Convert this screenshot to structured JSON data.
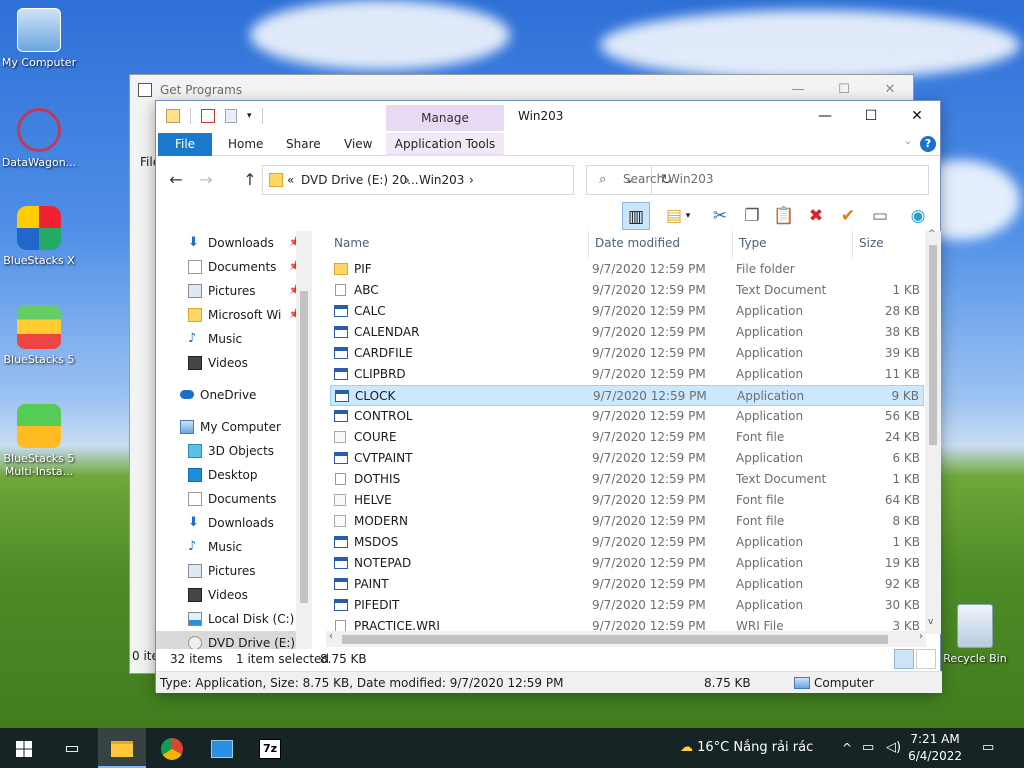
{
  "desktop": {
    "icons": [
      {
        "label": "My Computer"
      },
      {
        "label": "DataWagon..."
      },
      {
        "label": "BlueStacks X"
      },
      {
        "label": "BlueStacks 5"
      },
      {
        "label": "BlueStacks 5 Multi-Insta..."
      },
      {
        "label": "Recycle Bin"
      }
    ]
  },
  "background_window": {
    "title": "Get Programs",
    "menu_fragment": "File",
    "status_fragment": "0 ite",
    "minimize": "—",
    "maximize": "☐",
    "close": "✕"
  },
  "explorer": {
    "title": "Win203",
    "manage_tab": "Manage",
    "ribbon_tabs": {
      "file": "File",
      "home": "Home",
      "share": "Share",
      "view": "View",
      "app_tools": "Application Tools"
    },
    "controls": {
      "minimize": "—",
      "maximize": "☐",
      "close": "✕",
      "help": "?"
    },
    "address": {
      "prefix": "«",
      "segment1": "DVD Drive (E:) 20...",
      "sep1": "›",
      "segment2": "Win203",
      "sep2": "›"
    },
    "search": {
      "placeholder": "Search Win203"
    },
    "nav": {
      "quick": [
        {
          "label": "Downloads",
          "pin": true
        },
        {
          "label": "Documents",
          "pin": true
        },
        {
          "label": "Pictures",
          "pin": true
        },
        {
          "label": "Microsoft Wi",
          "pin": true
        },
        {
          "label": "Music",
          "pin": false
        },
        {
          "label": "Videos",
          "pin": false
        }
      ],
      "onedrive": "OneDrive",
      "computer": "My Computer",
      "computer_items": [
        {
          "label": "3D Objects"
        },
        {
          "label": "Desktop"
        },
        {
          "label": "Documents"
        },
        {
          "label": "Downloads"
        },
        {
          "label": "Music"
        },
        {
          "label": "Pictures"
        },
        {
          "label": "Videos"
        },
        {
          "label": "Local Disk (C:)"
        },
        {
          "label": "DVD Drive (E:) 2("
        }
      ]
    },
    "columns": {
      "name": "Name",
      "date": "Date modified",
      "type": "Type",
      "size": "Size"
    },
    "files": [
      {
        "name": "PIF",
        "date": "9/7/2020 12:59 PM",
        "type": "File folder",
        "size": "",
        "icon": "folder"
      },
      {
        "name": "ABC",
        "date": "9/7/2020 12:59 PM",
        "type": "Text Document",
        "size": "1 KB",
        "icon": "txt"
      },
      {
        "name": "CALC",
        "date": "9/7/2020 12:59 PM",
        "type": "Application",
        "size": "28 KB",
        "icon": "app"
      },
      {
        "name": "CALENDAR",
        "date": "9/7/2020 12:59 PM",
        "type": "Application",
        "size": "38 KB",
        "icon": "app"
      },
      {
        "name": "CARDFILE",
        "date": "9/7/2020 12:59 PM",
        "type": "Application",
        "size": "39 KB",
        "icon": "app"
      },
      {
        "name": "CLIPBRD",
        "date": "9/7/2020 12:59 PM",
        "type": "Application",
        "size": "11 KB",
        "icon": "app"
      },
      {
        "name": "CLOCK",
        "date": "9/7/2020 12:59 PM",
        "type": "Application",
        "size": "9 KB",
        "icon": "app",
        "selected": true
      },
      {
        "name": "CONTROL",
        "date": "9/7/2020 12:59 PM",
        "type": "Application",
        "size": "56 KB",
        "icon": "app"
      },
      {
        "name": "COURE",
        "date": "9/7/2020 12:59 PM",
        "type": "Font file",
        "size": "24 KB",
        "icon": "font"
      },
      {
        "name": "CVTPAINT",
        "date": "9/7/2020 12:59 PM",
        "type": "Application",
        "size": "6 KB",
        "icon": "app"
      },
      {
        "name": "DOTHIS",
        "date": "9/7/2020 12:59 PM",
        "type": "Text Document",
        "size": "1 KB",
        "icon": "txt"
      },
      {
        "name": "HELVE",
        "date": "9/7/2020 12:59 PM",
        "type": "Font file",
        "size": "64 KB",
        "icon": "font"
      },
      {
        "name": "MODERN",
        "date": "9/7/2020 12:59 PM",
        "type": "Font file",
        "size": "8 KB",
        "icon": "font"
      },
      {
        "name": "MSDOS",
        "date": "9/7/2020 12:59 PM",
        "type": "Application",
        "size": "1 KB",
        "icon": "app"
      },
      {
        "name": "NOTEPAD",
        "date": "9/7/2020 12:59 PM",
        "type": "Application",
        "size": "19 KB",
        "icon": "app"
      },
      {
        "name": "PAINT",
        "date": "9/7/2020 12:59 PM",
        "type": "Application",
        "size": "92 KB",
        "icon": "app"
      },
      {
        "name": "PIFEDIT",
        "date": "9/7/2020 12:59 PM",
        "type": "Application",
        "size": "30 KB",
        "icon": "app"
      },
      {
        "name": "PRACTICE.WRI",
        "date": "9/7/2020 12:59 PM",
        "type": "WRI File",
        "size": "3 KB",
        "icon": "txt"
      }
    ],
    "status": {
      "count": "32 items",
      "selected": "1 item selected",
      "selected_size": "8.75 KB"
    },
    "infobar": {
      "details": "Type: Application, Size: 8.75 KB, Date modified: 9/7/2020 12:59 PM",
      "size": "8.75 KB",
      "location": "Computer"
    }
  },
  "taskbar": {
    "weather": "16°C  Nắng rải rác",
    "time": "7:21 AM",
    "date": "6/4/2022",
    "tray_chevron": "^"
  }
}
